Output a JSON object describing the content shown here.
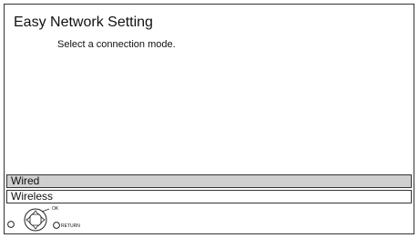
{
  "dialog": {
    "title": "Easy Network Setting",
    "subtitle": "Select a connection mode."
  },
  "options": [
    {
      "label": "Wired",
      "selected": true
    },
    {
      "label": "Wireless",
      "selected": false
    }
  ],
  "nav_hint": {
    "ok_label": "OK",
    "return_label": "RETURN",
    "icons": [
      "left-ring-icon",
      "dpad-icon",
      "return-ring-icon"
    ]
  },
  "colors": {
    "background": "#ffffff",
    "selected_row": "#cfcfcf",
    "border": "#333333",
    "text": "#111111"
  }
}
